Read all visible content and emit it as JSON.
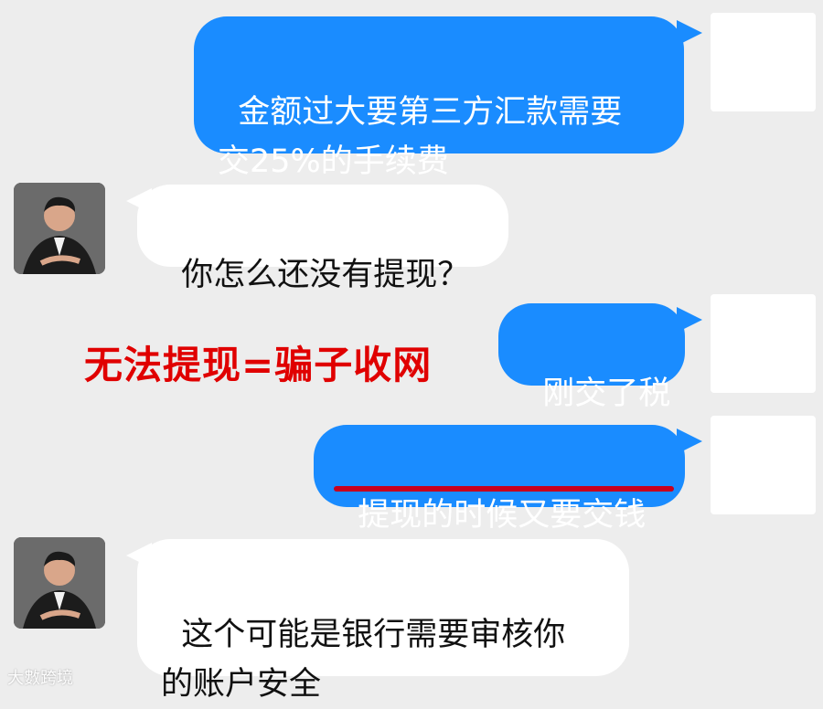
{
  "messages": [
    {
      "sender": "self",
      "text": "金额过大要第三方汇款需要\n交25%的手续费"
    },
    {
      "sender": "peer",
      "text": "你怎么还没有提现？"
    },
    {
      "sender": "self",
      "text": "刚交了税"
    },
    {
      "sender": "self",
      "text": "提现的时候又要交钱"
    },
    {
      "sender": "peer",
      "text": "这个可能是银行需要审核你\n的账户安全"
    }
  ],
  "annotation": "无法提现=骗子收网",
  "watermark": "大數跨境",
  "colors": {
    "self_bubble": "#1a8cff",
    "peer_bubble": "#ffffff",
    "annotation": "#e00000",
    "underline": "#c8001e",
    "background": "#ededed"
  }
}
